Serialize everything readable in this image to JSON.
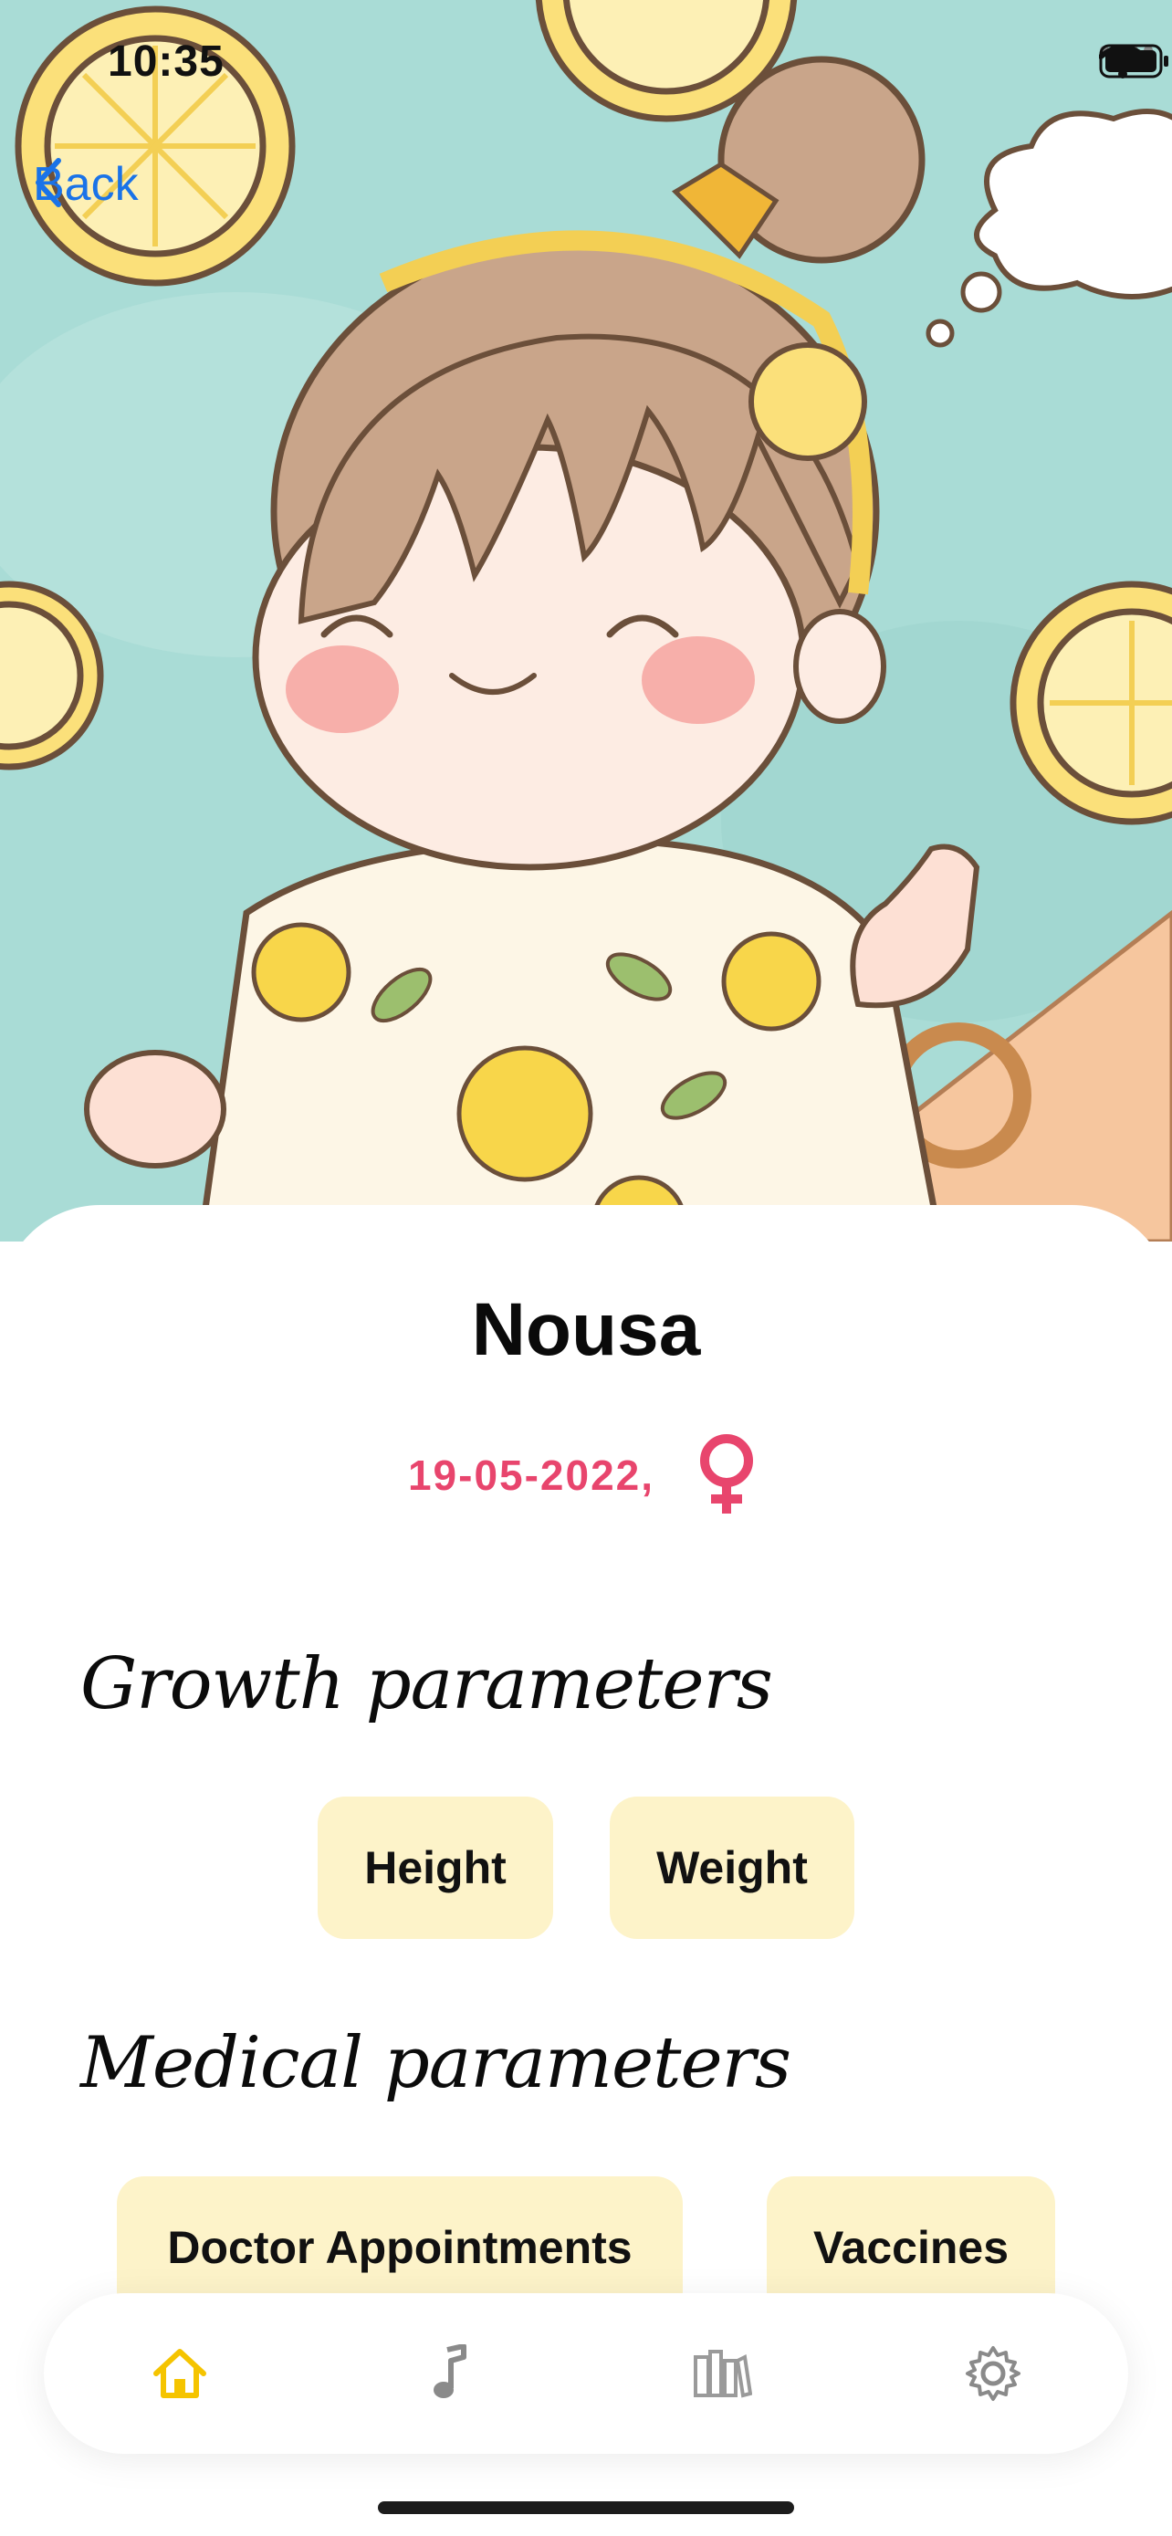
{
  "status_bar": {
    "time": "10:35"
  },
  "nav": {
    "back_label": "Back"
  },
  "profile": {
    "name": "Nousa",
    "birth_date": "19-05-2022,",
    "gender_icon": "female-symbol-icon",
    "accent_color": "#e8456d"
  },
  "growth": {
    "title": "Growth parameters",
    "items": [
      "Height",
      "Weight"
    ]
  },
  "medical": {
    "title": "Medical parameters",
    "items": [
      "Doctor Appointments",
      "Vaccines"
    ]
  },
  "tabbar": {
    "tabs": [
      {
        "icon": "home-icon",
        "active": true
      },
      {
        "icon": "music-note-icon",
        "active": false
      },
      {
        "icon": "books-icon",
        "active": false
      },
      {
        "icon": "gear-icon",
        "active": false
      }
    ],
    "active_color": "#f5c400"
  }
}
